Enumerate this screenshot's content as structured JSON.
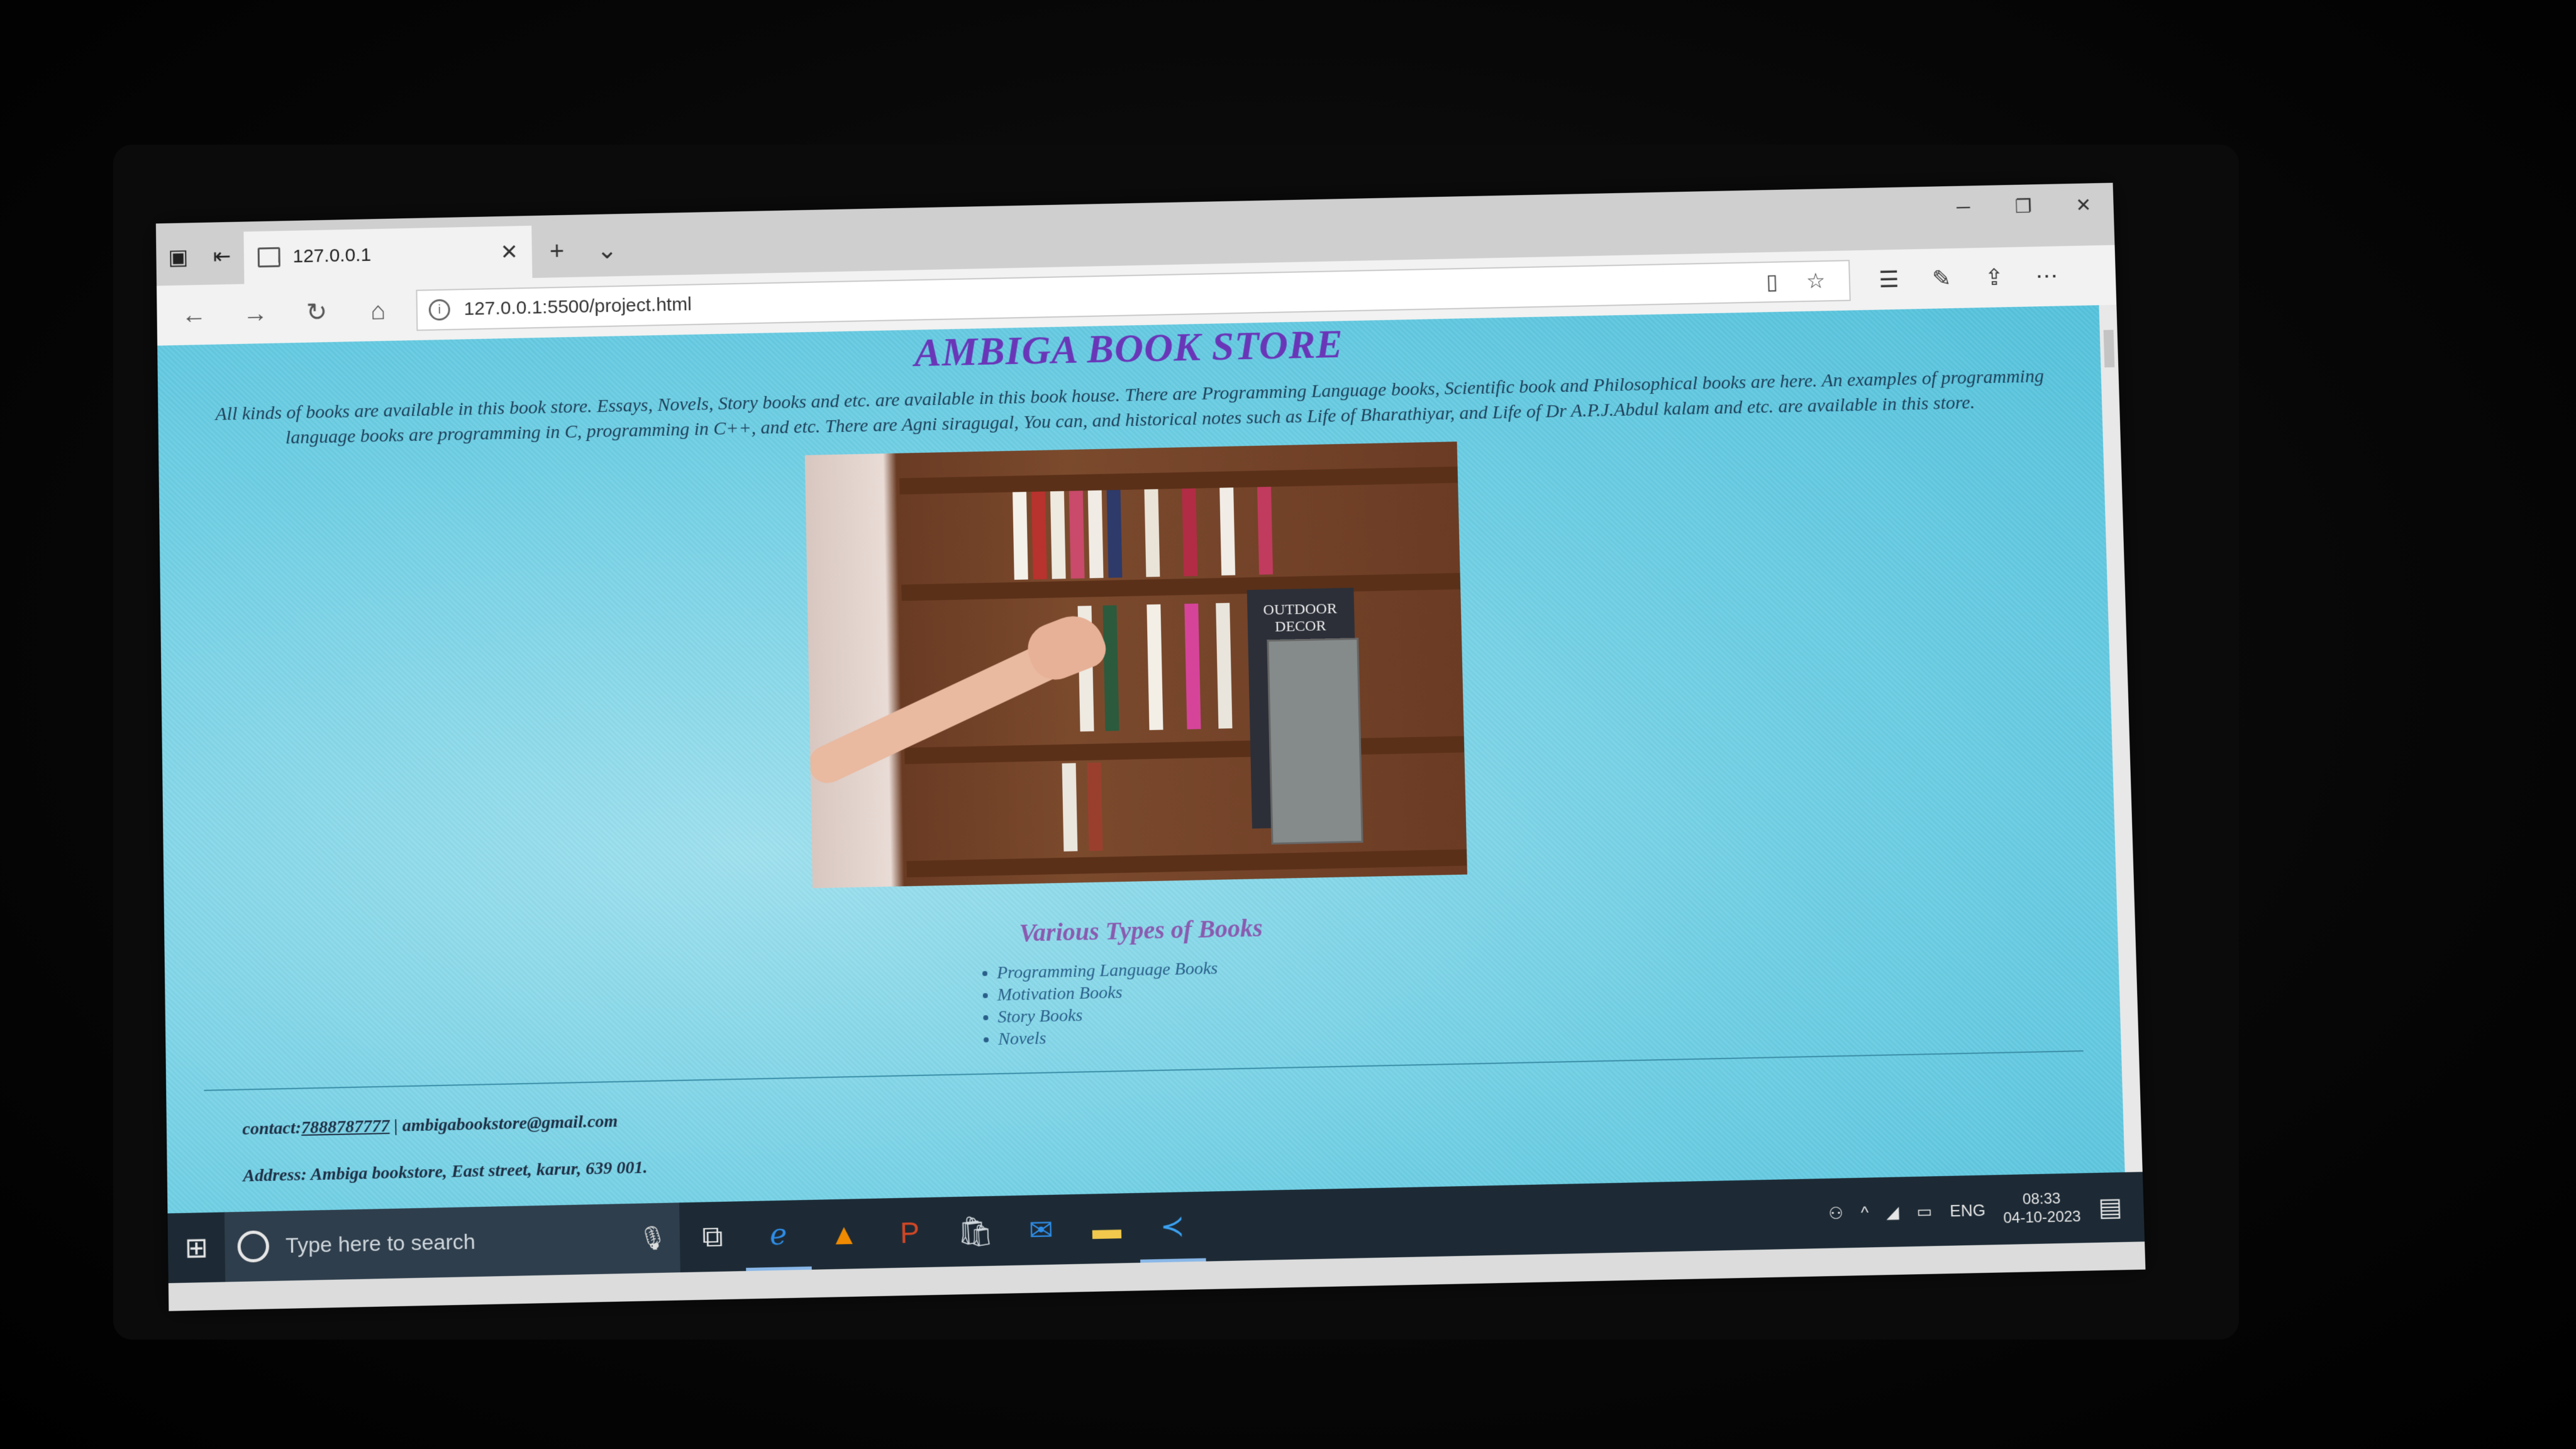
{
  "browser": {
    "tab_title": "127.0.0.1",
    "url": "127.0.0.1:5500/project.html",
    "new_tab_glyph": "+",
    "tab_list_glyph": "⌄",
    "close_glyph": "✕"
  },
  "page": {
    "title": "AMBIGA BOOK STORE",
    "intro": "All kinds of books are available in this book store. Essays, Novels, Story books and etc. are available in this book house. There are Programming Language books, Scientific book and Philosophical books are here. An examples of programming language books are programming in C, programming in C++, and etc. There are Agni siragugal, You can, and historical notes such as Life of Bharathiyar, and Life of Dr A.P.J.Abdul kalam and etc. are available in this store.",
    "hero_image_text": "OUTDOOR DECOR",
    "subheading": "Various Types of Books",
    "book_types": [
      "Programming Language Books",
      "Motivation Books",
      "Story Books",
      "Novels"
    ],
    "contact": {
      "label": "contact:",
      "phone": "7888787777",
      "separator": " | ",
      "email": "ambigabookstore@gmail.com"
    },
    "address": "Address: Ambiga bookstore, East street, karur, 639 001."
  },
  "taskbar": {
    "search_placeholder": "Type here to search",
    "language": "ENG",
    "time": "08:33",
    "date": "04-10-2023"
  },
  "colors": {
    "title": "#6a36b8",
    "subheading": "#8a5bb0",
    "page_background": "#6fcfe4",
    "taskbar": "#1d2a35"
  },
  "icons": [
    "window-icon",
    "tab-set-aside-icon",
    "back-icon",
    "forward-icon",
    "refresh-icon",
    "home-icon",
    "info-icon",
    "reading-view-icon",
    "favorite-star-icon",
    "favorites-list-icon",
    "pen-icon",
    "share-icon",
    "more-icon",
    "windows-start-icon",
    "cortana-icon",
    "microphone-icon",
    "task-view-icon",
    "edge-icon",
    "vlc-icon",
    "powerpoint-icon",
    "store-icon",
    "mail-icon",
    "explorer-icon",
    "vscode-icon",
    "people-icon",
    "chevron-up-icon",
    "wifi-icon",
    "battery-icon",
    "notification-icon"
  ]
}
